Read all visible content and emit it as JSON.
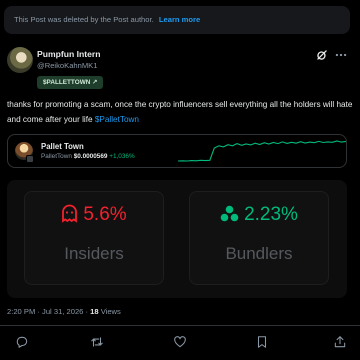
{
  "banner": {
    "text": "This Post was deleted by the Post author.",
    "link": "Learn more"
  },
  "author": {
    "name": "Pumpfun Intern",
    "handle": "@ReikoKahnMK1"
  },
  "ticker_pill": {
    "label": "$PALLETTOWN ↗"
  },
  "tweet": {
    "text": "thanks for promoting a scam, once the crypto influencers sell everything all the holders will hate and come after your life ",
    "cashtag": "$PalletTown"
  },
  "token": {
    "name": "Pallet Town",
    "symbol": "PalletTown",
    "price": "$0.0000569",
    "change": "+1,036%",
    "sparkline": [
      2,
      2.1,
      2,
      2.2,
      2.1,
      2.3,
      2.2,
      2.3,
      8,
      9,
      8.5,
      9.5,
      9,
      10,
      9.2,
      9.8,
      9.4,
      10.2,
      9.6,
      10.4,
      9.8,
      10.5,
      10,
      10.8,
      10.1,
      10.6,
      10.2,
      10.9,
      10.3,
      10.7,
      10.4,
      11,
      10.5,
      10.8,
      10.6,
      11.2,
      10.7,
      11
    ]
  },
  "stats": {
    "insiders": {
      "value": "5.6%",
      "label": "Insiders",
      "icon": "ghost-icon",
      "color": "#f4212e"
    },
    "bundlers": {
      "value": "2.23%",
      "label": "Bundlers",
      "icon": "bundle-icon",
      "color": "#00ba7c"
    }
  },
  "meta": {
    "timestamp": "2:20 PM · Jul 31, 2026 · ",
    "views_count": "18",
    "views_label": " Views"
  },
  "actions": [
    "reply-icon",
    "repost-icon",
    "like-icon",
    "bookmark-icon",
    "share-icon"
  ],
  "colors": {
    "accent": "#1d9bf0",
    "positive": "#00ba7c",
    "negative": "#f4212e",
    "muted": "#8b98a5"
  }
}
